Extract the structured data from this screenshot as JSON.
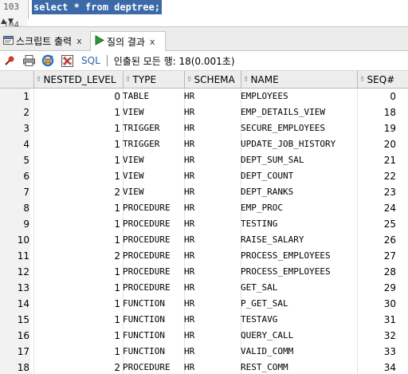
{
  "editor": {
    "line_numbers": [
      "103",
      "104"
    ],
    "code": "select * from deptree;"
  },
  "tabs": [
    {
      "label": "스크립트 출력",
      "close": "x",
      "icon": "script-output-icon"
    },
    {
      "label": "질의 결과",
      "close": "x",
      "icon": "run-query-icon"
    }
  ],
  "toolbar": {
    "sql_label": "SQL",
    "fetch_status": "인출된 모든 행: 18(0.001초)",
    "icons": [
      "pin-icon",
      "print-icon",
      "refresh-icon",
      "export-icon"
    ]
  },
  "grid": {
    "columns": [
      "NESTED_LEVEL",
      "TYPE",
      "SCHEMA",
      "NAME",
      "SEQ#"
    ],
    "rows": [
      {
        "idx": "1",
        "nested_level": "0",
        "type": "TABLE",
        "schema": "HR",
        "name": "EMPLOYEES",
        "seq": "0"
      },
      {
        "idx": "2",
        "nested_level": "1",
        "type": "VIEW",
        "schema": "HR",
        "name": "EMP_DETAILS_VIEW",
        "seq": "18"
      },
      {
        "idx": "3",
        "nested_level": "1",
        "type": "TRIGGER",
        "schema": "HR",
        "name": "SECURE_EMPLOYEES",
        "seq": "19"
      },
      {
        "idx": "4",
        "nested_level": "1",
        "type": "TRIGGER",
        "schema": "HR",
        "name": "UPDATE_JOB_HISTORY",
        "seq": "20"
      },
      {
        "idx": "5",
        "nested_level": "1",
        "type": "VIEW",
        "schema": "HR",
        "name": "DEPT_SUM_SAL",
        "seq": "21"
      },
      {
        "idx": "6",
        "nested_level": "1",
        "type": "VIEW",
        "schema": "HR",
        "name": "DEPT_COUNT",
        "seq": "22"
      },
      {
        "idx": "7",
        "nested_level": "2",
        "type": "VIEW",
        "schema": "HR",
        "name": "DEPT_RANKS",
        "seq": "23"
      },
      {
        "idx": "8",
        "nested_level": "1",
        "type": "PROCEDURE",
        "schema": "HR",
        "name": "EMP_PROC",
        "seq": "24"
      },
      {
        "idx": "9",
        "nested_level": "1",
        "type": "PROCEDURE",
        "schema": "HR",
        "name": "TESTING",
        "seq": "25"
      },
      {
        "idx": "10",
        "nested_level": "1",
        "type": "PROCEDURE",
        "schema": "HR",
        "name": "RAISE_SALARY",
        "seq": "26"
      },
      {
        "idx": "11",
        "nested_level": "2",
        "type": "PROCEDURE",
        "schema": "HR",
        "name": "PROCESS_EMPLOYEES",
        "seq": "27"
      },
      {
        "idx": "12",
        "nested_level": "1",
        "type": "PROCEDURE",
        "schema": "HR",
        "name": "PROCESS_EMPLOYEES",
        "seq": "28"
      },
      {
        "idx": "13",
        "nested_level": "1",
        "type": "PROCEDURE",
        "schema": "HR",
        "name": "GET_SAL",
        "seq": "29"
      },
      {
        "idx": "14",
        "nested_level": "1",
        "type": "FUNCTION",
        "schema": "HR",
        "name": "P_GET_SAL",
        "seq": "30"
      },
      {
        "idx": "15",
        "nested_level": "1",
        "type": "FUNCTION",
        "schema": "HR",
        "name": "TESTAVG",
        "seq": "31"
      },
      {
        "idx": "16",
        "nested_level": "1",
        "type": "FUNCTION",
        "schema": "HR",
        "name": "QUERY_CALL",
        "seq": "32"
      },
      {
        "idx": "17",
        "nested_level": "1",
        "type": "FUNCTION",
        "schema": "HR",
        "name": "VALID_COMM",
        "seq": "33"
      },
      {
        "idx": "18",
        "nested_level": "2",
        "type": "PROCEDURE",
        "schema": "HR",
        "name": "REST_COMM",
        "seq": "34"
      }
    ]
  },
  "colors": {
    "selection": "#3c6aa8",
    "sql_link": "#2a5fa8",
    "run_icon": "#2e9a2e"
  }
}
